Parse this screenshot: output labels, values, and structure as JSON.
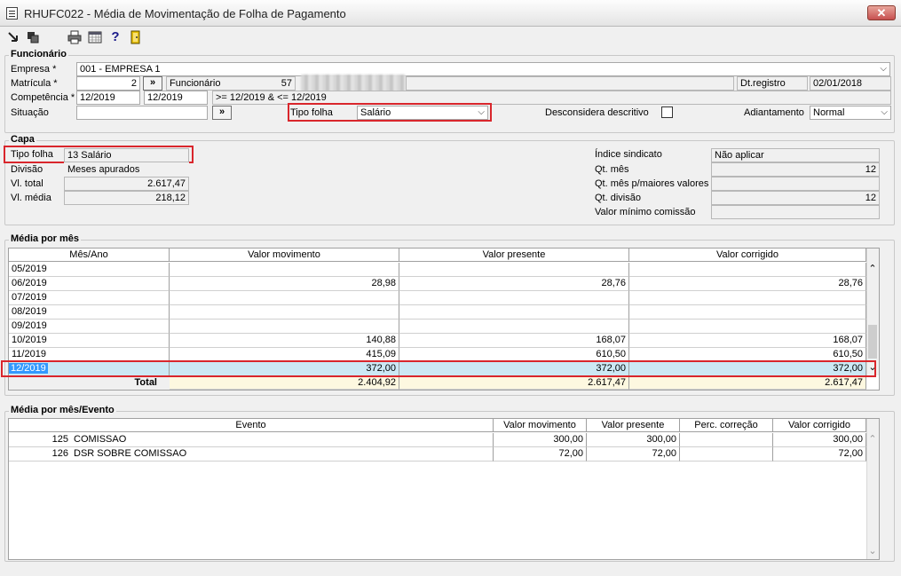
{
  "window": {
    "title": "RHUFC022 - Média de Movimentação de Folha de Pagamento",
    "close_glyph": "✕"
  },
  "toolbar": {
    "icons": [
      "exit-icon",
      "copy-icon",
      "print-icon",
      "calendar-icon",
      "help-icon",
      "door-icon"
    ]
  },
  "funcionario": {
    "legend": "Funcionário",
    "empresa_label": "Empresa *",
    "empresa_value": "001 - EMPRESA 1",
    "matricula_label": "Matrícula *",
    "matricula_value": "2",
    "nav_button": "»",
    "funcionario_label": "Funcionário",
    "funcionario_value": "57",
    "dtregistro_label": "Dt.registro",
    "dtregistro_value": "02/01/2018",
    "competencia_label": "Competência *",
    "competencia_start": "12/2019",
    "competencia_end": "12/2019",
    "competencia_filter": ">= 12/2019  &  <= 12/2019",
    "situacao_label": "Situação",
    "situacao_value": "",
    "situacao_button": "»",
    "tipofolha_label": "Tipo folha",
    "tipofolha_value": "Salário",
    "desconsidera_label": "Desconsidera descritivo",
    "adiantamento_label": "Adiantamento",
    "adiantamento_value": "Normal"
  },
  "capa": {
    "legend": "Capa",
    "tipofolha_label": "Tipo folha",
    "tipofolha_value": "13 Salário",
    "divisao_label": "Divisão",
    "divisao_value": "Meses apurados",
    "vltotal_label": "Vl. total",
    "vltotal_value": "2.617,47",
    "vlmedia_label": "Vl. média",
    "vlmedia_value": "218,12",
    "indice_label": "Índice sindicato",
    "indice_value": "Não aplicar",
    "qtmes_label": "Qt. mês",
    "qtmes_value": "12",
    "qtmesmaiores_label": "Qt. mês p/maiores valores",
    "qtmesmaiores_value": "",
    "qtdivisao_label": "Qt. divisão",
    "qtdivisao_value": "12",
    "valorminimo_label": "Valor mínimo comissão",
    "valorminimo_value": ""
  },
  "media_mes": {
    "legend": "Média por mês",
    "columns": [
      "Mês/Ano",
      "Valor movimento",
      "Valor presente",
      "Valor corrigido"
    ],
    "rows": [
      {
        "mes": "05/2019",
        "mov": "",
        "pres": "",
        "corr": ""
      },
      {
        "mes": "06/2019",
        "mov": "28,98",
        "pres": "28,76",
        "corr": "28,76"
      },
      {
        "mes": "07/2019",
        "mov": "",
        "pres": "",
        "corr": ""
      },
      {
        "mes": "08/2019",
        "mov": "",
        "pres": "",
        "corr": ""
      },
      {
        "mes": "09/2019",
        "mov": "",
        "pres": "",
        "corr": ""
      },
      {
        "mes": "10/2019",
        "mov": "140,88",
        "pres": "168,07",
        "corr": "168,07"
      },
      {
        "mes": "11/2019",
        "mov": "415,09",
        "pres": "610,50",
        "corr": "610,50"
      },
      {
        "mes": "12/2019",
        "mov": "372,00",
        "pres": "372,00",
        "corr": "372,00"
      }
    ],
    "total_label": "Total",
    "total_mov": "2.404,92",
    "total_pres": "2.617,47",
    "total_corr": "2.617,47"
  },
  "media_evento": {
    "legend": "Média por mês/Evento",
    "columns": [
      "Evento",
      "Valor movimento",
      "Valor presente",
      "Perc. correção",
      "Valor corrigido"
    ],
    "rows": [
      {
        "codigo": "125",
        "evento": "COMISSAO",
        "mov": "300,00",
        "pres": "300,00",
        "perc": "",
        "corr": "300,00"
      },
      {
        "codigo": "126",
        "evento": "DSR SOBRE COMISSAO",
        "mov": "72,00",
        "pres": "72,00",
        "perc": "",
        "corr": "72,00"
      }
    ]
  },
  "colors": {
    "highlight_red": "#d9262c",
    "selected_row": "#cce8f4",
    "selected_cell": "#3399ff",
    "total_row": "#fdf8e0"
  }
}
